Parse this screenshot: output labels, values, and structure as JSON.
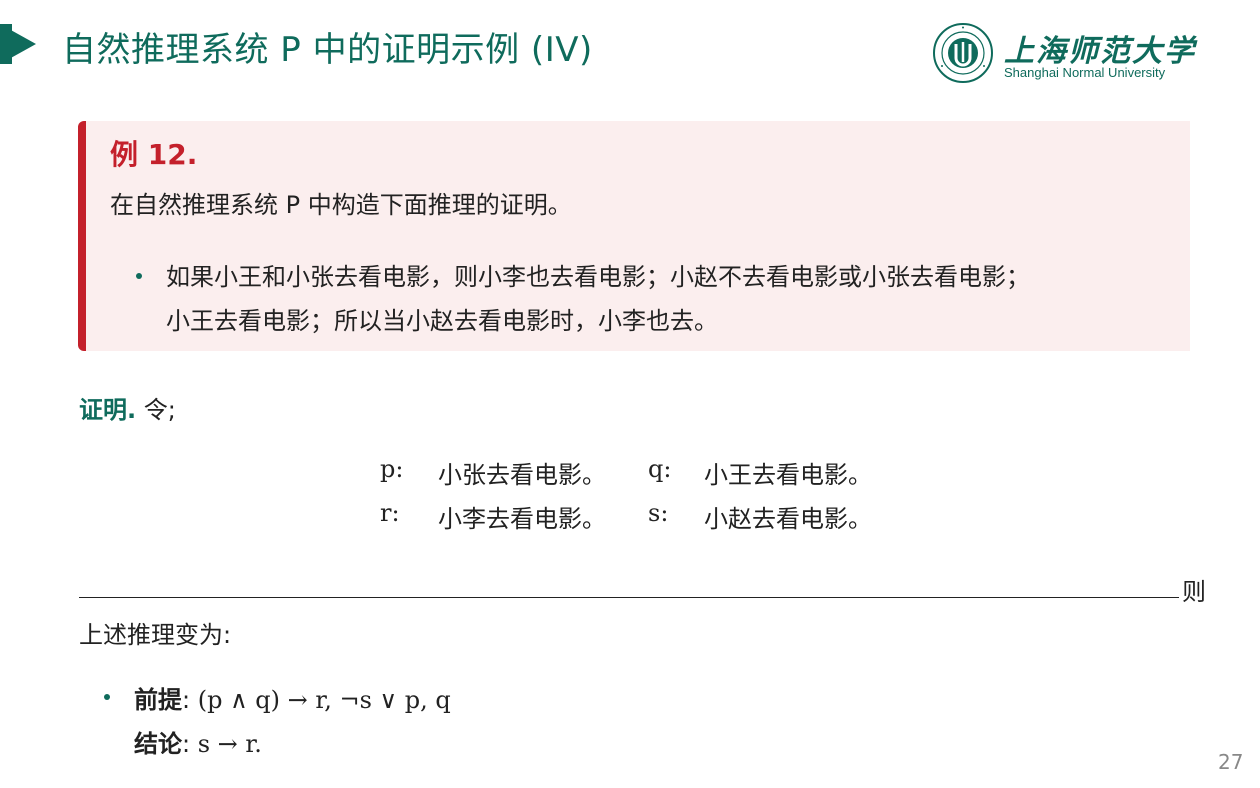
{
  "header": {
    "title": "自然推理系统 P 中的证明示例 (IV)",
    "logo_cn": "上海师范大学",
    "logo_en": "Shanghai Normal University",
    "accent_color": "#0f6b5c"
  },
  "example": {
    "title": "例 12.",
    "text": "在自然推理系统 P 中构造下面推理的证明。",
    "bullet_line1": "如果小王和小张去看电影，则小李也去看电影；小赵不去看电影或小张去看电影；",
    "bullet_line2": "小王去看电影；所以当小赵去看电影时，小李也去。",
    "accent_color": "#c4202b"
  },
  "proof": {
    "label": "证明.",
    "text": "令;"
  },
  "definitions": [
    {
      "var": "p:",
      "text": "小张去看电影。"
    },
    {
      "var": "q:",
      "text": "小王去看电影。"
    },
    {
      "var": "r:",
      "text": "小李去看电影。"
    },
    {
      "var": "s:",
      "text": "小赵去看电影。"
    }
  ],
  "ze": "则",
  "reasoning_intro": "上述推理变为:",
  "premise": {
    "label": "前提",
    "sep": ": ",
    "formula": "(p ∧ q) → r,  ¬s ∨ p, q"
  },
  "conclusion": {
    "label": "结论",
    "sep": ": ",
    "formula": "s → r."
  },
  "page_number": "27"
}
